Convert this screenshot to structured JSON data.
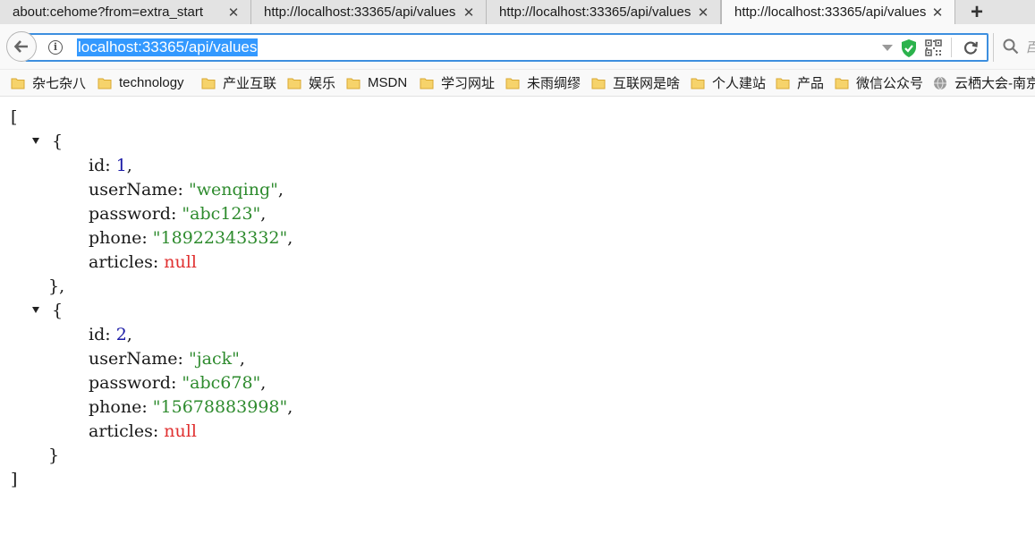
{
  "tabs": [
    {
      "title": "about:cehome?from=extra_start",
      "close": "✕"
    },
    {
      "title": "http://localhost:33365/api/values",
      "close": "✕"
    },
    {
      "title": "http://localhost:33365/api/values",
      "close": "✕"
    },
    {
      "title": "http://localhost:33365/api/values",
      "close": "✕",
      "active": true
    }
  ],
  "new_tab_label": "+",
  "address_bar": {
    "url": "localhost:33365/api/values",
    "info_glyph": "i"
  },
  "search_hint": "百",
  "bookmarks": [
    {
      "label": "杂七杂八",
      "icon": "folder-icon"
    },
    {
      "label": "technology",
      "icon": "folder-icon"
    },
    {
      "label": "产业互联",
      "icon": "folder-icon"
    },
    {
      "label": "娱乐",
      "icon": "folder-icon"
    },
    {
      "label": "MSDN",
      "icon": "folder-icon"
    },
    {
      "label": "学习网址",
      "icon": "folder-icon"
    },
    {
      "label": "未雨绸缪",
      "icon": "folder-icon"
    },
    {
      "label": "互联网是啥",
      "icon": "folder-icon"
    },
    {
      "label": "个人建站",
      "icon": "folder-icon"
    },
    {
      "label": "产品",
      "icon": "folder-icon"
    },
    {
      "label": "微信公众号",
      "icon": "folder-icon"
    },
    {
      "label": "云栖大会-南京",
      "icon": "globe-icon"
    }
  ],
  "json": {
    "open_bracket": "[",
    "close_bracket": "]",
    "open_brace": "{",
    "close_brace_comma": "},",
    "close_brace": "}",
    "items": [
      {
        "id": "1",
        "userName": "\"wenqing\"",
        "password": "\"abc123\"",
        "phone": "\"18922343332\"",
        "articles": "null"
      },
      {
        "id": "2",
        "userName": "\"jack\"",
        "password": "\"abc678\"",
        "phone": "\"15678883998\"",
        "articles": "null"
      }
    ],
    "keys": {
      "id": "id",
      "userName": "userName",
      "password": "password",
      "phone": "phone",
      "articles": "articles"
    },
    "colon": ": ",
    "comma": ","
  },
  "colors": {
    "number": "#1a1aa6",
    "string": "#2e8b2e",
    "null": "#e03030",
    "url_highlight": "#3399ff",
    "focus_border": "#3d8fdf"
  }
}
